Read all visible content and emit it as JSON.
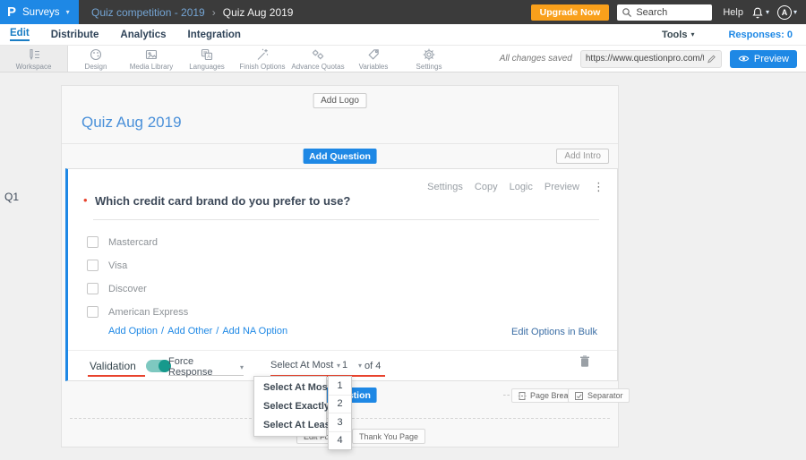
{
  "glyphs": {
    "caret": "▾",
    "chevron": "›",
    "more": "⋮",
    "slash": "/",
    "required": "•",
    "logo": "P"
  },
  "topbar": {
    "product": "Surveys",
    "breadcrumb_parent": "Quiz competition - 2019",
    "breadcrumb_current": "Quiz Aug 2019",
    "upgrade": "Upgrade Now",
    "search_placeholder": "Search",
    "help": "Help",
    "avatar": "A"
  },
  "nav": {
    "items": [
      {
        "label": "Edit"
      },
      {
        "label": "Distribute"
      },
      {
        "label": "Analytics"
      },
      {
        "label": "Integration"
      }
    ],
    "tools": "Tools",
    "responses": "Responses: 0"
  },
  "toolbar": {
    "items": [
      {
        "label": "Workspace"
      },
      {
        "label": "Design"
      },
      {
        "label": "Media Library"
      },
      {
        "label": "Languages"
      },
      {
        "label": "Finish Options"
      },
      {
        "label": "Advance Quotas"
      },
      {
        "label": "Variables"
      },
      {
        "label": "Settings"
      }
    ],
    "saved": "All changes saved",
    "url": "https://www.questionpro.com/t/APNrFZ",
    "preview": "Preview"
  },
  "survey": {
    "add_logo": "Add Logo",
    "title": "Quiz Aug 2019",
    "add_question": "Add Question",
    "add_intro": "Add Intro",
    "page_break": "Page Break",
    "separator": "Separator",
    "edit_footer": "Edit Footer",
    "thank_you": "Thank You Page"
  },
  "question": {
    "id": "Q1",
    "text": "Which credit card brand do you prefer to use?",
    "actions": [
      {
        "label": "Settings"
      },
      {
        "label": "Copy"
      },
      {
        "label": "Logic"
      },
      {
        "label": "Preview"
      }
    ],
    "options": [
      {
        "label": "Mastercard"
      },
      {
        "label": "Visa"
      },
      {
        "label": "Discover"
      },
      {
        "label": "American Express"
      }
    ],
    "add_links": [
      {
        "label": "Add Option"
      },
      {
        "label": "Add Other"
      },
      {
        "label": "Add NA Option"
      }
    ],
    "bulk_edit": "Edit Options in Bulk"
  },
  "validation": {
    "label": "Validation",
    "force_response": "Force Response",
    "rule": "Select At Most",
    "count": "1",
    "of": "of 4"
  },
  "dropdowns": {
    "rules": [
      {
        "label": "Select At Most"
      },
      {
        "label": "Select Exactly"
      },
      {
        "label": "Select At Least"
      }
    ],
    "counts": [
      {
        "label": "1"
      },
      {
        "label": "2"
      },
      {
        "label": "3"
      },
      {
        "label": "4"
      }
    ]
  },
  "colors": {
    "accent_blue": "#1e88e5",
    "dark_bar": "#3b3b3b",
    "upgrade_orange": "#f9a01b",
    "toggle_teal": "#17998c",
    "annotation_red": "#e8432d",
    "title_blue": "#4a90d9"
  }
}
